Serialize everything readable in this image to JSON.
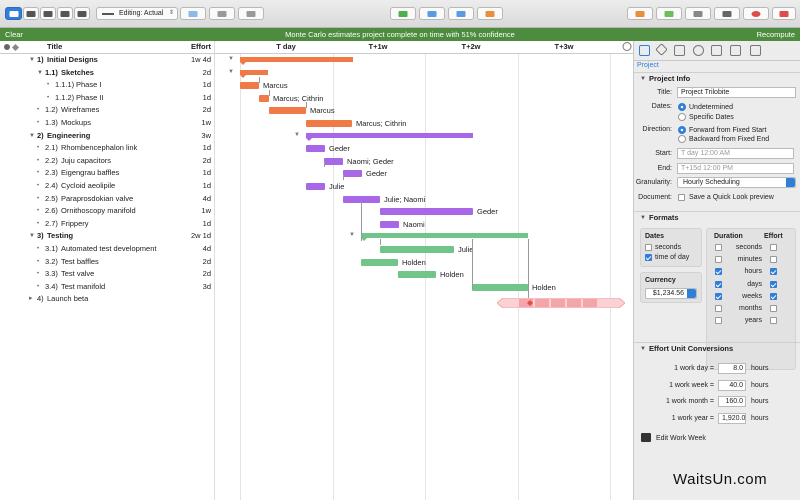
{
  "toolbar": {
    "editing_label": "Editing: Actual",
    "editing_arrow": "⇕"
  },
  "banner": {
    "left": "Clear",
    "message": "Monte Carlo estimates project complete on time with 51% confidence",
    "right": "Recompute"
  },
  "outline": {
    "header_title": "Title",
    "header_effort": "Effort",
    "rows": [
      {
        "num": "1)",
        "title": "Initial Designs",
        "effort": "1w 4d"
      },
      {
        "num": "1.1)",
        "title": "Sketches",
        "effort": "2d"
      },
      {
        "num": "1.1.1)",
        "title": "Phase I",
        "effort": "1d"
      },
      {
        "num": "1.1.2)",
        "title": "Phase II",
        "effort": "1d"
      },
      {
        "num": "1.2)",
        "title": "Wireframes",
        "effort": "2d"
      },
      {
        "num": "1.3)",
        "title": "Mockups",
        "effort": "1w"
      },
      {
        "num": "2)",
        "title": "Engineering",
        "effort": "3w"
      },
      {
        "num": "2.1)",
        "title": "Rhombencephalon link",
        "effort": "1d"
      },
      {
        "num": "2.2)",
        "title": "Juju capacitors",
        "effort": "2d"
      },
      {
        "num": "2.3)",
        "title": "Eigengrau baffles",
        "effort": "1d"
      },
      {
        "num": "2.4)",
        "title": "Cycloid aeolipile",
        "effort": "1d"
      },
      {
        "num": "2.5)",
        "title": "Paraprosdokian valve",
        "effort": "4d"
      },
      {
        "num": "2.6)",
        "title": "Ornithoscopy manifold",
        "effort": "1w"
      },
      {
        "num": "2.7)",
        "title": "Frippery",
        "effort": "1d"
      },
      {
        "num": "3)",
        "title": "Testing",
        "effort": "2w 1d"
      },
      {
        "num": "3.1)",
        "title": "Automated test development",
        "effort": "4d"
      },
      {
        "num": "3.2)",
        "title": "Test baffles",
        "effort": "2d"
      },
      {
        "num": "3.3)",
        "title": "Test valve",
        "effort": "2d"
      },
      {
        "num": "3.4)",
        "title": "Test manifold",
        "effort": "3d"
      },
      {
        "num": "4)",
        "title": "Launch beta",
        "effort": ""
      }
    ]
  },
  "gantt": {
    "ticks": [
      "T day",
      "T+1w",
      "T+2w",
      "T+3w"
    ],
    "labels": [
      "Marcus",
      "Marcus; Cithrin",
      "Marcus",
      "Marcus; Cithrin",
      "Geder",
      "Naomi; Geder",
      "Geder",
      "Julie",
      "Julie; Naomi",
      "Geder",
      "Naomi",
      "Julie",
      "Holden",
      "Holden",
      "Holden"
    ],
    "colors": {
      "design": "#ef7a45",
      "engineering": "#a867e6",
      "testing": "#71c48a",
      "milestone": "#f3a5aa"
    }
  },
  "inspector": {
    "subtitle": "Project",
    "project_info": "Project Info",
    "title_label": "Title:",
    "title_value": "Project Trilobite",
    "dates_label": "Dates:",
    "dates_opt1": "Undetermined",
    "dates_opt2": "Specific Dates",
    "direction_label": "Direction:",
    "dir_opt1": "Forward from Fixed Start",
    "dir_opt2": "Backward from Fixed End",
    "start_label": "Start:",
    "start_value": "T day 12:00 AM",
    "end_label": "End:",
    "end_value": "T+15d 12:00 PM",
    "granularity_label": "Granularity:",
    "granularity_value": "Hourly Scheduling",
    "document_label": "Document:",
    "document_value": "Save a Quick Look preview",
    "formats": "Formats",
    "dates_box": "Dates",
    "seconds": "seconds",
    "time_of_day": "time of day",
    "currency": "Currency",
    "currency_value": "$1,234.56",
    "duration": "Duration",
    "effort": "Effort",
    "units": [
      "seconds",
      "minutes",
      "hours",
      "days",
      "weeks",
      "months",
      "years"
    ],
    "duration_checked": [
      false,
      false,
      true,
      true,
      true,
      false,
      false
    ],
    "effort_checked": [
      false,
      false,
      true,
      true,
      true,
      false,
      false
    ],
    "conversions": "Effort Unit Conversions",
    "conv_rows": [
      {
        "label": "1 work day =",
        "value": "8.0",
        "unit": "hours"
      },
      {
        "label": "1 work week =",
        "value": "40.0",
        "unit": "hours"
      },
      {
        "label": "1 work month =",
        "value": "160.0",
        "unit": "hours"
      },
      {
        "label": "1 work year =",
        "value": "1,920.0",
        "unit": "hours"
      }
    ],
    "edit_work_week": "Edit Work Week"
  },
  "watermark": "WaitsUn.com"
}
